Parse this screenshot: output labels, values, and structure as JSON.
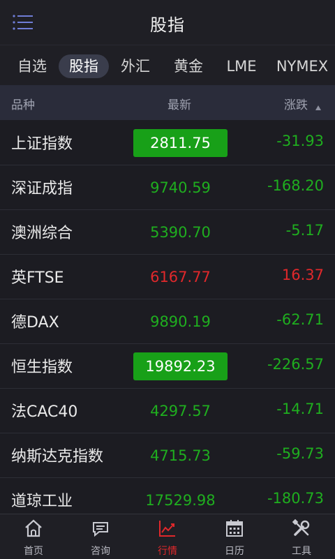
{
  "header": {
    "title": "股指"
  },
  "tabs": [
    {
      "label": "自选"
    },
    {
      "label": "股指"
    },
    {
      "label": "外汇"
    },
    {
      "label": "黄金"
    },
    {
      "label": "LME"
    },
    {
      "label": "NYMEX"
    }
  ],
  "active_tab": "股指",
  "columns": {
    "name": "品种",
    "latest": "最新",
    "change": "涨跌"
  },
  "rows": [
    {
      "name": "上证指数",
      "price": "2811.75",
      "change": "-31.93",
      "trend": "down",
      "highlight": true
    },
    {
      "name": "深证成指",
      "price": "9740.59",
      "change": "-168.20",
      "trend": "down",
      "highlight": false
    },
    {
      "name": "澳洲综合",
      "price": "5390.70",
      "change": "-5.17",
      "trend": "down",
      "highlight": false
    },
    {
      "name": "英FTSE",
      "price": "6167.77",
      "change": "16.37",
      "trend": "up",
      "highlight": false
    },
    {
      "name": "德DAX",
      "price": "9890.19",
      "change": "-62.71",
      "trend": "down",
      "highlight": false
    },
    {
      "name": "恒生指数",
      "price": "19892.23",
      "change": "-226.57",
      "trend": "down",
      "highlight": true
    },
    {
      "name": "法CAC40",
      "price": "4297.57",
      "change": "-14.71",
      "trend": "down",
      "highlight": false
    },
    {
      "name": "纳斯达克指数",
      "price": "4715.73",
      "change": "-59.73",
      "trend": "down",
      "highlight": false
    },
    {
      "name": "道琼工业",
      "price": "17529.98",
      "change": "-180.73",
      "trend": "down",
      "highlight": false
    }
  ],
  "tabbar": [
    {
      "label": "首页",
      "icon": "home-icon"
    },
    {
      "label": "咨询",
      "icon": "chat-icon"
    },
    {
      "label": "行情",
      "icon": "chart-icon"
    },
    {
      "label": "日历",
      "icon": "calendar-icon"
    },
    {
      "label": "工具",
      "icon": "tools-icon"
    }
  ],
  "active_tabbar": "行情",
  "colors": {
    "up": "#e0282b",
    "down": "#1fae1f",
    "highlight_bg": "#18a018",
    "background": "#1c1c22",
    "header_bg": "#2a2c3a"
  }
}
